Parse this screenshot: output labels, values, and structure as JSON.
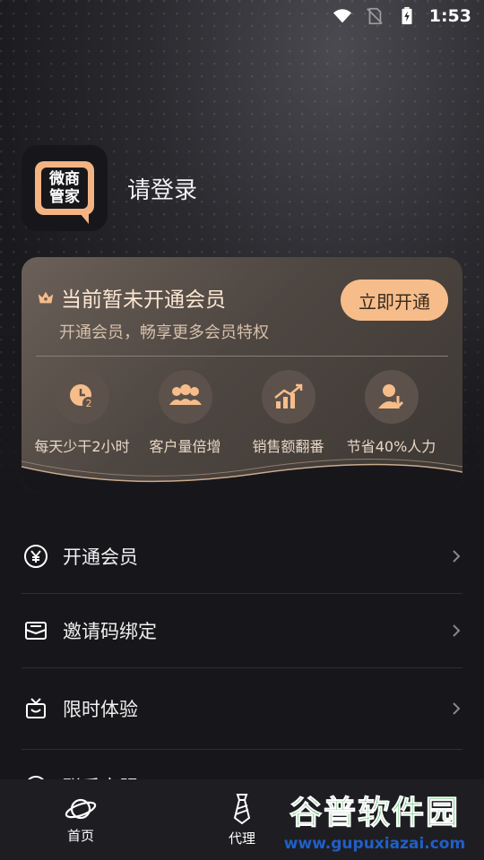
{
  "status_bar": {
    "time": "1:53"
  },
  "profile": {
    "logo_text": [
      "微商",
      "管家"
    ],
    "login_label": "请登录"
  },
  "vip_card": {
    "title": "当前暂未开通会员",
    "subtitle": "开通会员，畅享更多会员特权",
    "button": "立即开通",
    "perks": [
      {
        "label": "每天少干2小时",
        "icon": "clock-icon"
      },
      {
        "label": "客户量倍增",
        "icon": "users-icon"
      },
      {
        "label": "销售额翻番",
        "icon": "growth-chart-icon"
      },
      {
        "label": "节省40%人力",
        "icon": "person-save-icon"
      }
    ]
  },
  "menu": [
    {
      "label": "开通会员",
      "icon": "yen-circle-icon"
    },
    {
      "label": "邀请码绑定",
      "icon": "envelope-icon"
    },
    {
      "label": "限时体验",
      "icon": "gift-box-icon"
    },
    {
      "label": "联系客服",
      "icon": "headset-icon"
    }
  ],
  "bottom_nav": [
    {
      "label": "首页",
      "icon": "planet-icon"
    },
    {
      "label": "代理",
      "icon": "tie-icon"
    }
  ],
  "watermark": {
    "title": "谷普软件园",
    "url": "www.gupuxiazai.com"
  },
  "colors": {
    "accent": "#f6bd8b",
    "background": "#17171b",
    "card": "#4e4641"
  }
}
